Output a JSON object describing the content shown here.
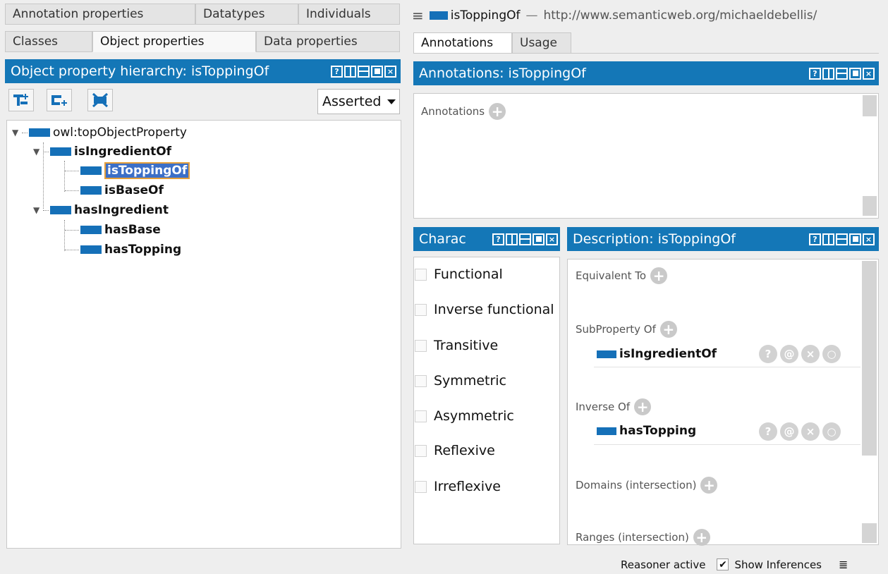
{
  "tabs_row1": [
    "Annotation properties",
    "Datatypes",
    "Individuals"
  ],
  "tabs_row2": [
    "Classes",
    "Object properties",
    "Data properties"
  ],
  "hierarchy": {
    "title": "Object property hierarchy: isToppingOf",
    "asserted": "Asserted",
    "nodes": {
      "root": "owl:topObjectProperty",
      "n1": "isIngredientOf",
      "n1a": "isToppingOf",
      "n1b": "isBaseOf",
      "n2": "hasIngredient",
      "n2a": "hasBase",
      "n2b": "hasTopping"
    }
  },
  "entity_header": {
    "name": "isToppingOf",
    "separator": "—",
    "iri": "http://www.semanticweb.org/michaeldebellis/"
  },
  "right_tabs": [
    "Annotations",
    "Usage"
  ],
  "annotations": {
    "title": "Annotations: isToppingOf",
    "label": "Annotations"
  },
  "characteristics": {
    "title": "Charac",
    "items": [
      "Functional",
      "Inverse functional",
      "Transitive",
      "Symmetric",
      "Asymmetric",
      "Reflexive",
      "Irreflexive"
    ]
  },
  "description": {
    "title": "Description: isToppingOf",
    "equivalent": "Equivalent To",
    "subproperty": "SubProperty Of",
    "subproperty_value": "isIngredientOf",
    "inverse": "Inverse Of",
    "inverse_value": "hasTopping",
    "domains": "Domains (intersection)",
    "ranges": "Ranges (intersection)"
  },
  "statusbar": {
    "reasoner": "Reasoner active",
    "show_inferences": "Show Inferences"
  },
  "colors": {
    "header_blue": "#1477b7",
    "property_blue": "#1570b8"
  }
}
